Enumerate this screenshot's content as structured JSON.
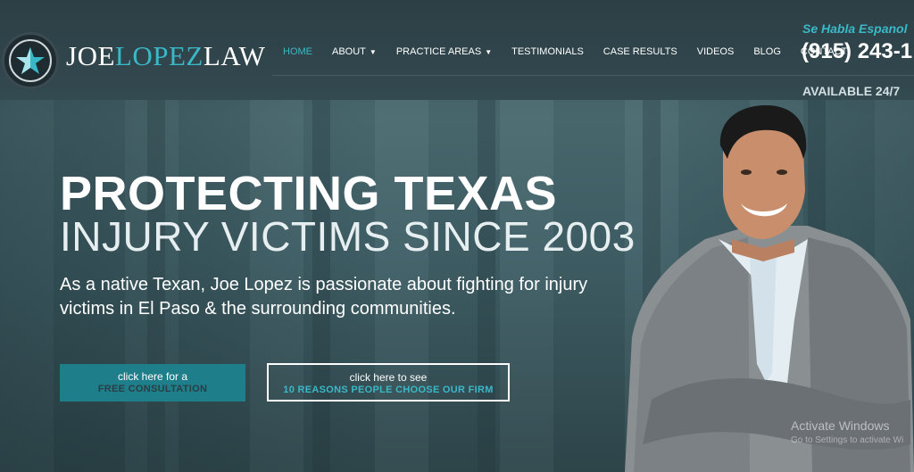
{
  "brand": {
    "logo_part1": "JOE",
    "logo_part2": "LOPEZ",
    "logo_part3": "LAW",
    "accent_color": "#3bb8c8",
    "logo_icon": "star-icon"
  },
  "nav": {
    "items": [
      {
        "label": "HOME",
        "active": true,
        "dropdown": false
      },
      {
        "label": "ABOUT",
        "active": false,
        "dropdown": true
      },
      {
        "label": "PRACTICE AREAS",
        "active": false,
        "dropdown": true
      },
      {
        "label": "TESTIMONIALS",
        "active": false,
        "dropdown": false
      },
      {
        "label": "CASE RESULTS",
        "active": false,
        "dropdown": false
      },
      {
        "label": "VIDEOS",
        "active": false,
        "dropdown": false
      },
      {
        "label": "BLOG",
        "active": false,
        "dropdown": false
      },
      {
        "label": "CONTACT",
        "active": false,
        "dropdown": false
      }
    ],
    "caret": "▼"
  },
  "contact": {
    "spanish": "Se Habla Espanol",
    "phone": "(915) 243-1",
    "availability": "AVAILABLE 24/7"
  },
  "hero": {
    "headline": "PROTECTING TEXAS",
    "subheadline": "INJURY VICTIMS SINCE 2003",
    "intro": "As a native Texan, Joe Lopez is passionate about fighting for injury victims in El Paso & the surrounding communities."
  },
  "cta": {
    "consult_line1": "click here for a",
    "consult_line2": "FREE CONSULTATION",
    "reasons_line1": "click here to see",
    "reasons_line2": "10 REASONS PEOPLE CHOOSE OUR FIRM"
  },
  "watermark": {
    "title": "Activate Windows",
    "subtitle": "Go to Settings to activate Wi"
  }
}
